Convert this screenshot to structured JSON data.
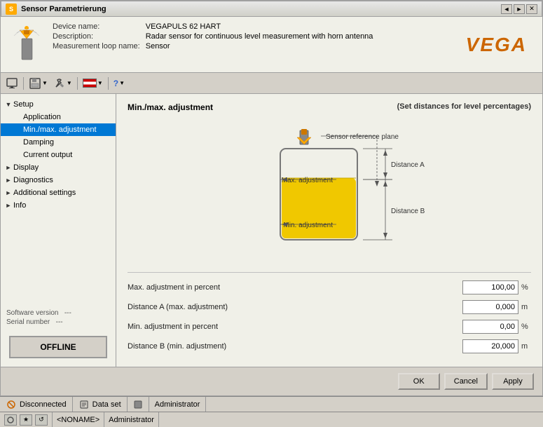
{
  "titleBar": {
    "icon": "S",
    "title": "Sensor Parametrierung",
    "controls": [
      "◄",
      "►",
      "✕"
    ]
  },
  "deviceInfo": {
    "deviceName": "VEGAPULS 62 HART",
    "deviceNameLabel": "Device name:",
    "description": "Radar sensor for continuous level measurement with horn antenna",
    "descriptionLabel": "Description:",
    "measurementLoopName": "Sensor",
    "measurementLoopLabel": "Measurement loop name:",
    "logo": "VEGA"
  },
  "toolbar": {
    "buttons": [
      "🖥",
      "💾",
      "🔧",
      "🌐",
      "❓"
    ]
  },
  "tree": {
    "items": [
      {
        "id": "setup",
        "label": "Setup",
        "level": 0,
        "expanded": true,
        "hasExpander": true
      },
      {
        "id": "application",
        "label": "Application",
        "level": 1,
        "selected": false
      },
      {
        "id": "min-max",
        "label": "Min./max. adjustment",
        "level": 1,
        "selected": true
      },
      {
        "id": "damping",
        "label": "Damping",
        "level": 1,
        "selected": false
      },
      {
        "id": "current-output",
        "label": "Current output",
        "level": 1,
        "selected": false
      },
      {
        "id": "display",
        "label": "Display",
        "level": 0,
        "expanded": false,
        "hasExpander": true
      },
      {
        "id": "diagnostics",
        "label": "Diagnostics",
        "level": 0,
        "expanded": false,
        "hasExpander": true
      },
      {
        "id": "additional",
        "label": "Additional settings",
        "level": 0,
        "expanded": false,
        "hasExpander": true
      },
      {
        "id": "info",
        "label": "Info",
        "level": 0,
        "expanded": false,
        "hasExpander": true
      }
    ]
  },
  "sidebarInfo": {
    "softwareVersionLabel": "Software version",
    "softwareVersionValue": "---",
    "serialNumberLabel": "Serial number",
    "serialNumberValue": "---"
  },
  "offlineButton": "OFFLINE",
  "panel": {
    "title": "Min./max. adjustment",
    "subtitle": "(Set distances for level percentages)",
    "diagram": {
      "sensorReferencePlaneLabel": "Sensor reference plane",
      "maxAdjustmentLabel": "Max. adjustment",
      "minAdjustmentLabel": "Min. adjustment",
      "distanceALabel": "Distance A",
      "distanceBLabel": "Distance B"
    },
    "formFields": [
      {
        "label": "Max. adjustment in percent",
        "value": "100,00",
        "unit": "%"
      },
      {
        "label": "Distance A (max. adjustment)",
        "value": "0,000",
        "unit": "m"
      },
      {
        "label": "Min. adjustment in percent",
        "value": "0,00",
        "unit": "%"
      },
      {
        "label": "Distance B (min. adjustment)",
        "value": "20,000",
        "unit": "m"
      }
    ]
  },
  "buttons": {
    "ok": "OK",
    "cancel": "Cancel",
    "apply": "Apply"
  },
  "statusBar": {
    "disconnectedLabel": "Disconnected",
    "dataSetLabel": "Data set",
    "adminLabel": "Administrator"
  },
  "taskbar": {
    "noname": "<NONAME>",
    "admin": "Administrator"
  }
}
